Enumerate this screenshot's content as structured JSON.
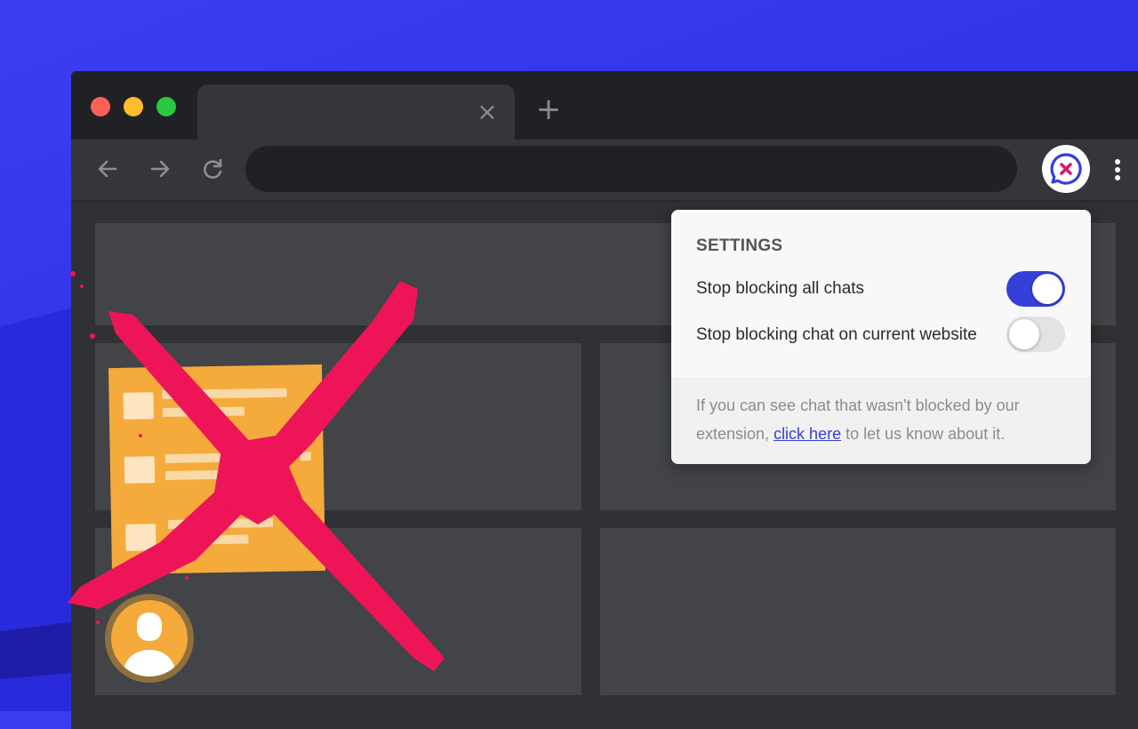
{
  "colors": {
    "accent": "#3540d8",
    "cross": "#ee1458",
    "chat_card": "#f5aa3c",
    "browser_dark": "#202124",
    "toolbar": "#35363a"
  },
  "browser": {
    "tab": {
      "close_icon": "close-icon"
    },
    "new_tab_icon": "plus-icon",
    "toolbar": {
      "back_icon": "arrow-left-icon",
      "forward_icon": "arrow-right-icon",
      "reload_icon": "reload-icon",
      "extension_icon": "chat-blocker-icon",
      "menu_icon": "more-vertical-icon"
    }
  },
  "popup": {
    "title": "SETTINGS",
    "options": [
      {
        "label": "Stop blocking all chats",
        "enabled": true
      },
      {
        "label": "Stop blocking chat on current website",
        "enabled": false
      }
    ],
    "note": {
      "before": "If you can see chat that wasn't blocked by our extension, ",
      "link": "click here",
      "after": " to let us know about it."
    }
  }
}
